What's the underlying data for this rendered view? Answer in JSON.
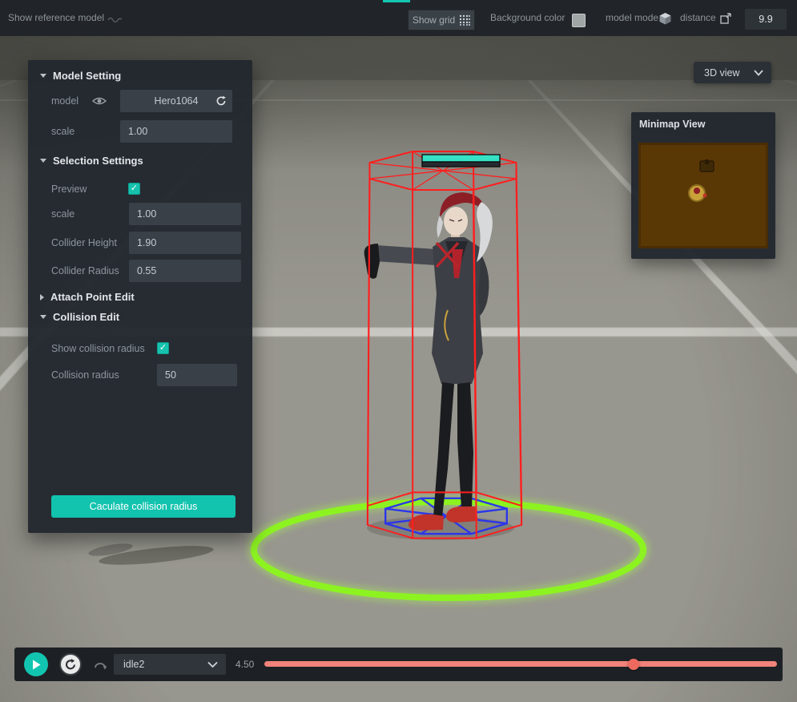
{
  "toolbar": {
    "show_reference_model_label": "Show reference model",
    "show_grid_label": "Show grid",
    "background_color_label": "Background color",
    "model_mode_label": "model mode",
    "distance_label": "distance",
    "distance_value": "9.9"
  },
  "viewport": {
    "view_dropdown_label": "3D view"
  },
  "model_panel": {
    "model_setting_header": "Model Setting",
    "model_label": "model",
    "model_name": "Hero1064",
    "scale_label": "scale",
    "scale_value": "1.00",
    "selection_settings_header": "Selection Settings",
    "preview_label": "Preview",
    "selection_scale_label": "scale",
    "selection_scale_value": "1.00",
    "collider_height_label": "Collider Height",
    "collider_height_value": "1.90",
    "collider_radius_label": "Collider Radius",
    "collider_radius_value": "0.55",
    "attach_point_header": "Attach Point Edit",
    "collision_edit_header": "Collision Edit",
    "show_collision_radius_label": "Show collision radius",
    "collision_radius_label": "Collision radius",
    "collision_radius_value": "50",
    "calculate_button_label": "Caculate collision radius"
  },
  "minimap": {
    "title": "Minimap View"
  },
  "playback": {
    "animation_name": "idle2",
    "time_value": "4.50",
    "progress_pct": 72
  },
  "colors": {
    "accent_teal": "#14c7b2",
    "slider_red": "#f2837a",
    "collider_cage_red": "#ff1e1e",
    "collision_radius_green": "#8cf321",
    "base_wheel_blue": "#2731f0",
    "health_bar_teal": "#36e0c4"
  }
}
